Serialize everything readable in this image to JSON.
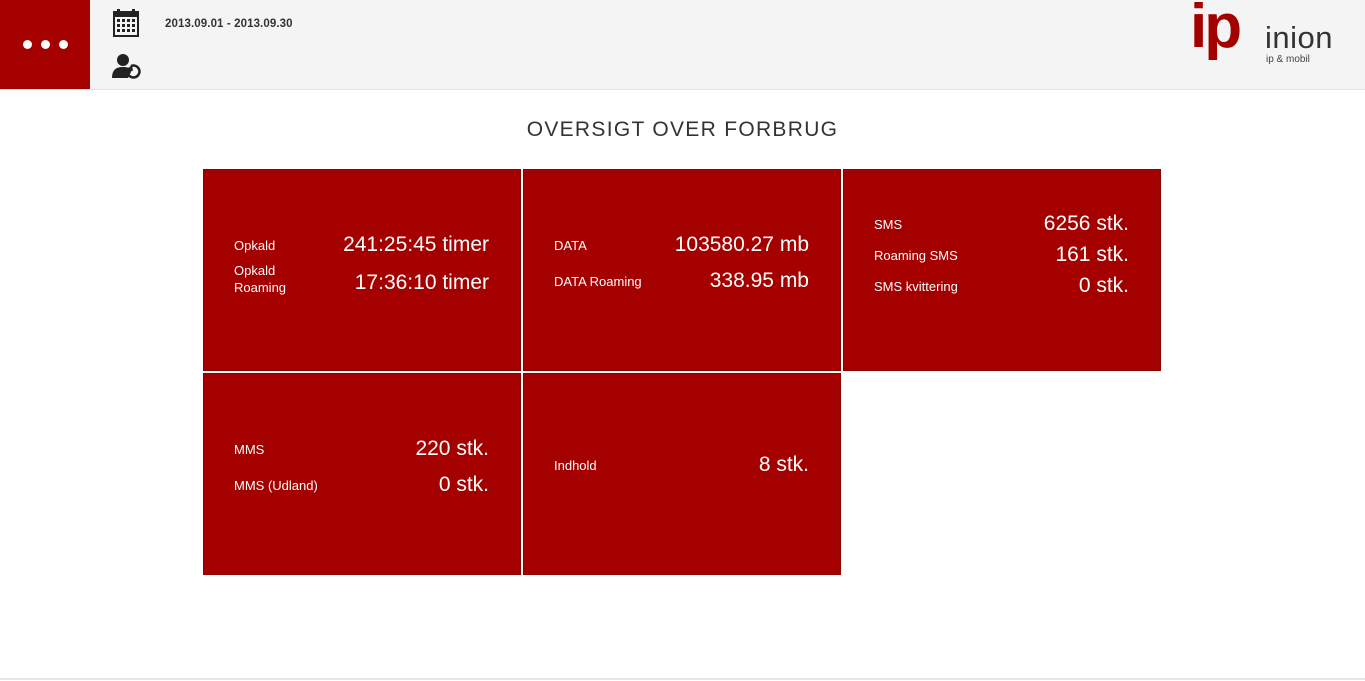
{
  "header": {
    "date_range": "2013.09.01 - 2013.09.30",
    "menu_icon": "more-dots-icon",
    "calendar_icon": "calendar-icon",
    "user_icon": "user-refresh-icon"
  },
  "logo": {
    "mark": "ip",
    "brand": "inion",
    "tagline": "ip & mobil",
    "brand_color": "#a50000"
  },
  "page": {
    "title": "OVERSIGT OVER FORBRUG"
  },
  "colors": {
    "accent": "#a50000",
    "header_bg": "#f4f4f4",
    "text": "#333333"
  },
  "tiles": [
    {
      "rows": [
        {
          "label": "Opkald",
          "value": "241:25:45 timer"
        },
        {
          "label": "Opkald Roaming",
          "value": "17:36:10 timer"
        }
      ]
    },
    {
      "rows": [
        {
          "label": "DATA",
          "value": "103580.27 mb"
        },
        {
          "label": "DATA Roaming",
          "value": "338.95 mb"
        }
      ]
    },
    {
      "rows": [
        {
          "label": "SMS",
          "value": "6256 stk."
        },
        {
          "label": "Roaming SMS",
          "value": "161 stk."
        },
        {
          "label": "SMS kvittering",
          "value": "0 stk."
        }
      ]
    },
    {
      "rows": [
        {
          "label": "MMS",
          "value": "220 stk."
        },
        {
          "label": "MMS (Udland)",
          "value": "0 stk."
        }
      ]
    },
    {
      "rows": [
        {
          "label": "Indhold",
          "value": "8 stk."
        }
      ]
    }
  ]
}
